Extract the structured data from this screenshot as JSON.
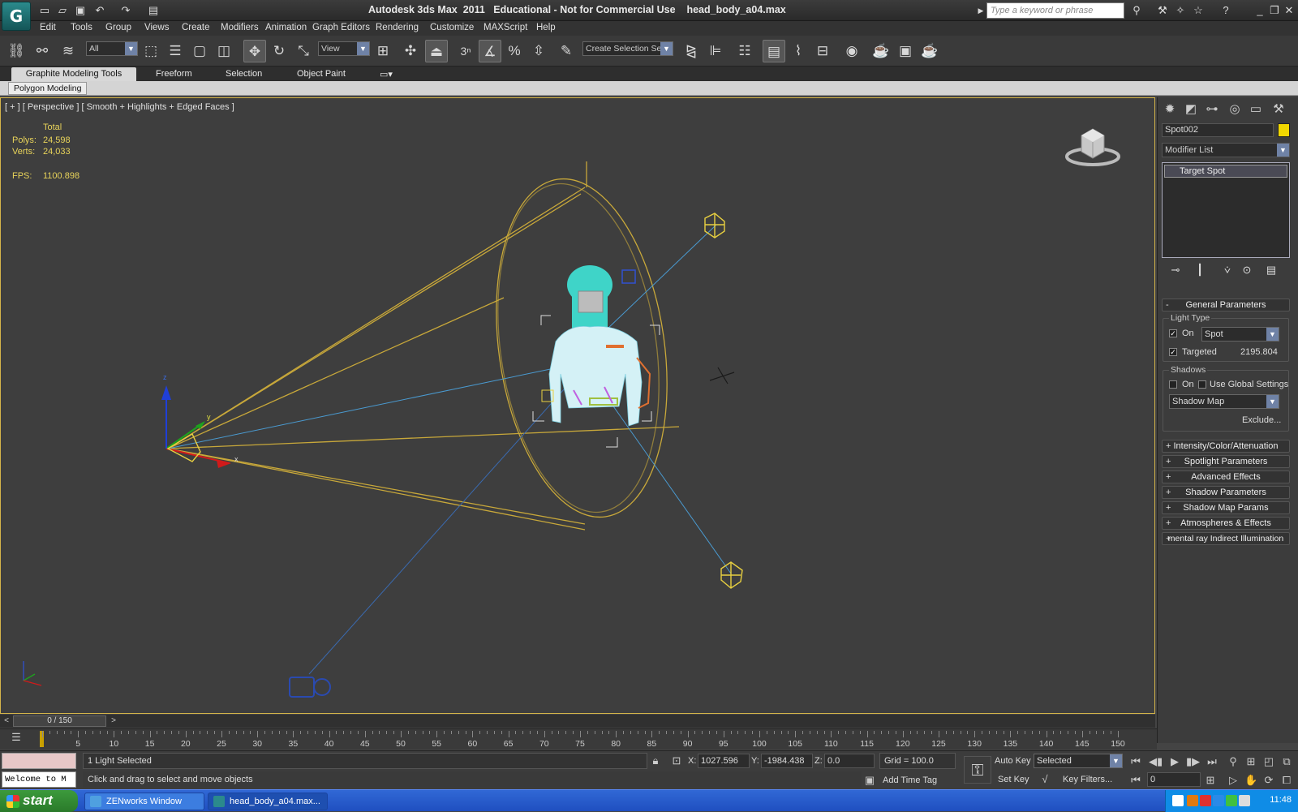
{
  "app": {
    "title": "Autodesk 3ds Max  2011   Educational - Not for Commercial Use    head_body_a04.max",
    "search_placeholder": "Type a keyword or phrase"
  },
  "menu": [
    "Edit",
    "Tools",
    "Group",
    "Views",
    "Create",
    "Modifiers",
    "Animation",
    "Graph Editors",
    "Rendering",
    "Customize",
    "MAXScript",
    "Help"
  ],
  "toolbar": {
    "selection_filter": "All",
    "ref_coord": "View",
    "selection_set_placeholder": "Create Selection Se",
    "snap_label": "3"
  },
  "ribbon": {
    "tabs": [
      "Graphite Modeling Tools",
      "Freeform",
      "Selection",
      "Object Paint"
    ],
    "active_tab": "Graphite Modeling Tools",
    "panel": "Polygon Modeling"
  },
  "viewport": {
    "label": "[ + ] [ Perspective ] [ Smooth + Highlights + Edged Faces ]",
    "stats_header": "Total",
    "polys_label": "Polys:",
    "polys": "24,598",
    "verts_label": "Verts:",
    "verts": "24,033",
    "fps_label": "FPS:",
    "fps": "1100.898"
  },
  "command_panel": {
    "object_name": "Spot002",
    "object_color": "#f1d700",
    "modifier_list": "Modifier List",
    "stack_item": "Target Spot",
    "general_params": "General Parameters",
    "light_type_group": "Light Type",
    "on_label": "On",
    "light_type": "Spot",
    "targeted_label": "Targeted",
    "target_distance": "2195.804",
    "shadows_group": "Shadows",
    "shadows_on_label": "On",
    "use_global_label": "Use Global Settings",
    "shadow_type": "Shadow Map",
    "exclude_label": "Exclude...",
    "rollouts": [
      "Intensity/Color/Attenuation",
      "Spotlight Parameters",
      "Advanced Effects",
      "Shadow Parameters",
      "Shadow Map Params",
      "Atmospheres & Effects",
      "mental ray Indirect Illumination"
    ]
  },
  "timeline": {
    "frame_display": "0 / 150",
    "ticks": [
      "5",
      "10",
      "15",
      "20",
      "25",
      "30",
      "35",
      "40",
      "45",
      "50",
      "55",
      "60",
      "65",
      "70",
      "75",
      "80",
      "85",
      "90",
      "95",
      "100",
      "105",
      "110",
      "115",
      "120",
      "125",
      "130",
      "135",
      "140",
      "145",
      "150"
    ]
  },
  "status": {
    "welcome": "Welcome to M",
    "selection_info": "1 Light Selected",
    "prompt": "Click and drag to select and move objects",
    "x_label": "X:",
    "x": "1027.596",
    "y_label": "Y:",
    "y": "-1984.438",
    "z_label": "Z:",
    "z": "0.0",
    "grid": "Grid = 100.0",
    "add_time_tag": "Add Time Tag",
    "auto_key": "Auto Key",
    "set_key": "Set Key",
    "key_mode": "Selected",
    "key_filters": "Key Filters...",
    "current_frame": "0"
  },
  "taskbar": {
    "start": "start",
    "tasks": [
      "ZENworks Window",
      "head_body_a04.max..."
    ],
    "clock": "11:48"
  }
}
